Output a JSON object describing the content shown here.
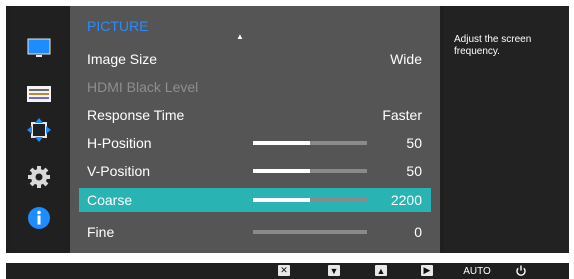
{
  "sidebar": {
    "items": [
      {
        "name": "monitor-icon"
      },
      {
        "name": "adjust-icon"
      },
      {
        "name": "resize-icon"
      },
      {
        "name": "gear-icon"
      },
      {
        "name": "info-icon"
      }
    ]
  },
  "menu": {
    "title": "PICTURE",
    "rows": [
      {
        "label": "Image Size",
        "value": "Wide"
      },
      {
        "label": "HDMI Black Level",
        "value": ""
      },
      {
        "label": "Response Time",
        "value": "Faster"
      },
      {
        "label": "H-Position",
        "value": "50",
        "level": 0.5
      },
      {
        "label": "V-Position",
        "value": "50",
        "level": 0.5
      },
      {
        "label": "Coarse",
        "value": "2200",
        "level": 0.5
      },
      {
        "label": "Fine",
        "value": "0",
        "level": 0.0
      }
    ]
  },
  "help": {
    "text": "Adjust the screen frequency."
  },
  "bottom": {
    "auto_label": "AUTO"
  },
  "colors": {
    "accent": "#29b3b3",
    "title": "#2a8bff"
  }
}
